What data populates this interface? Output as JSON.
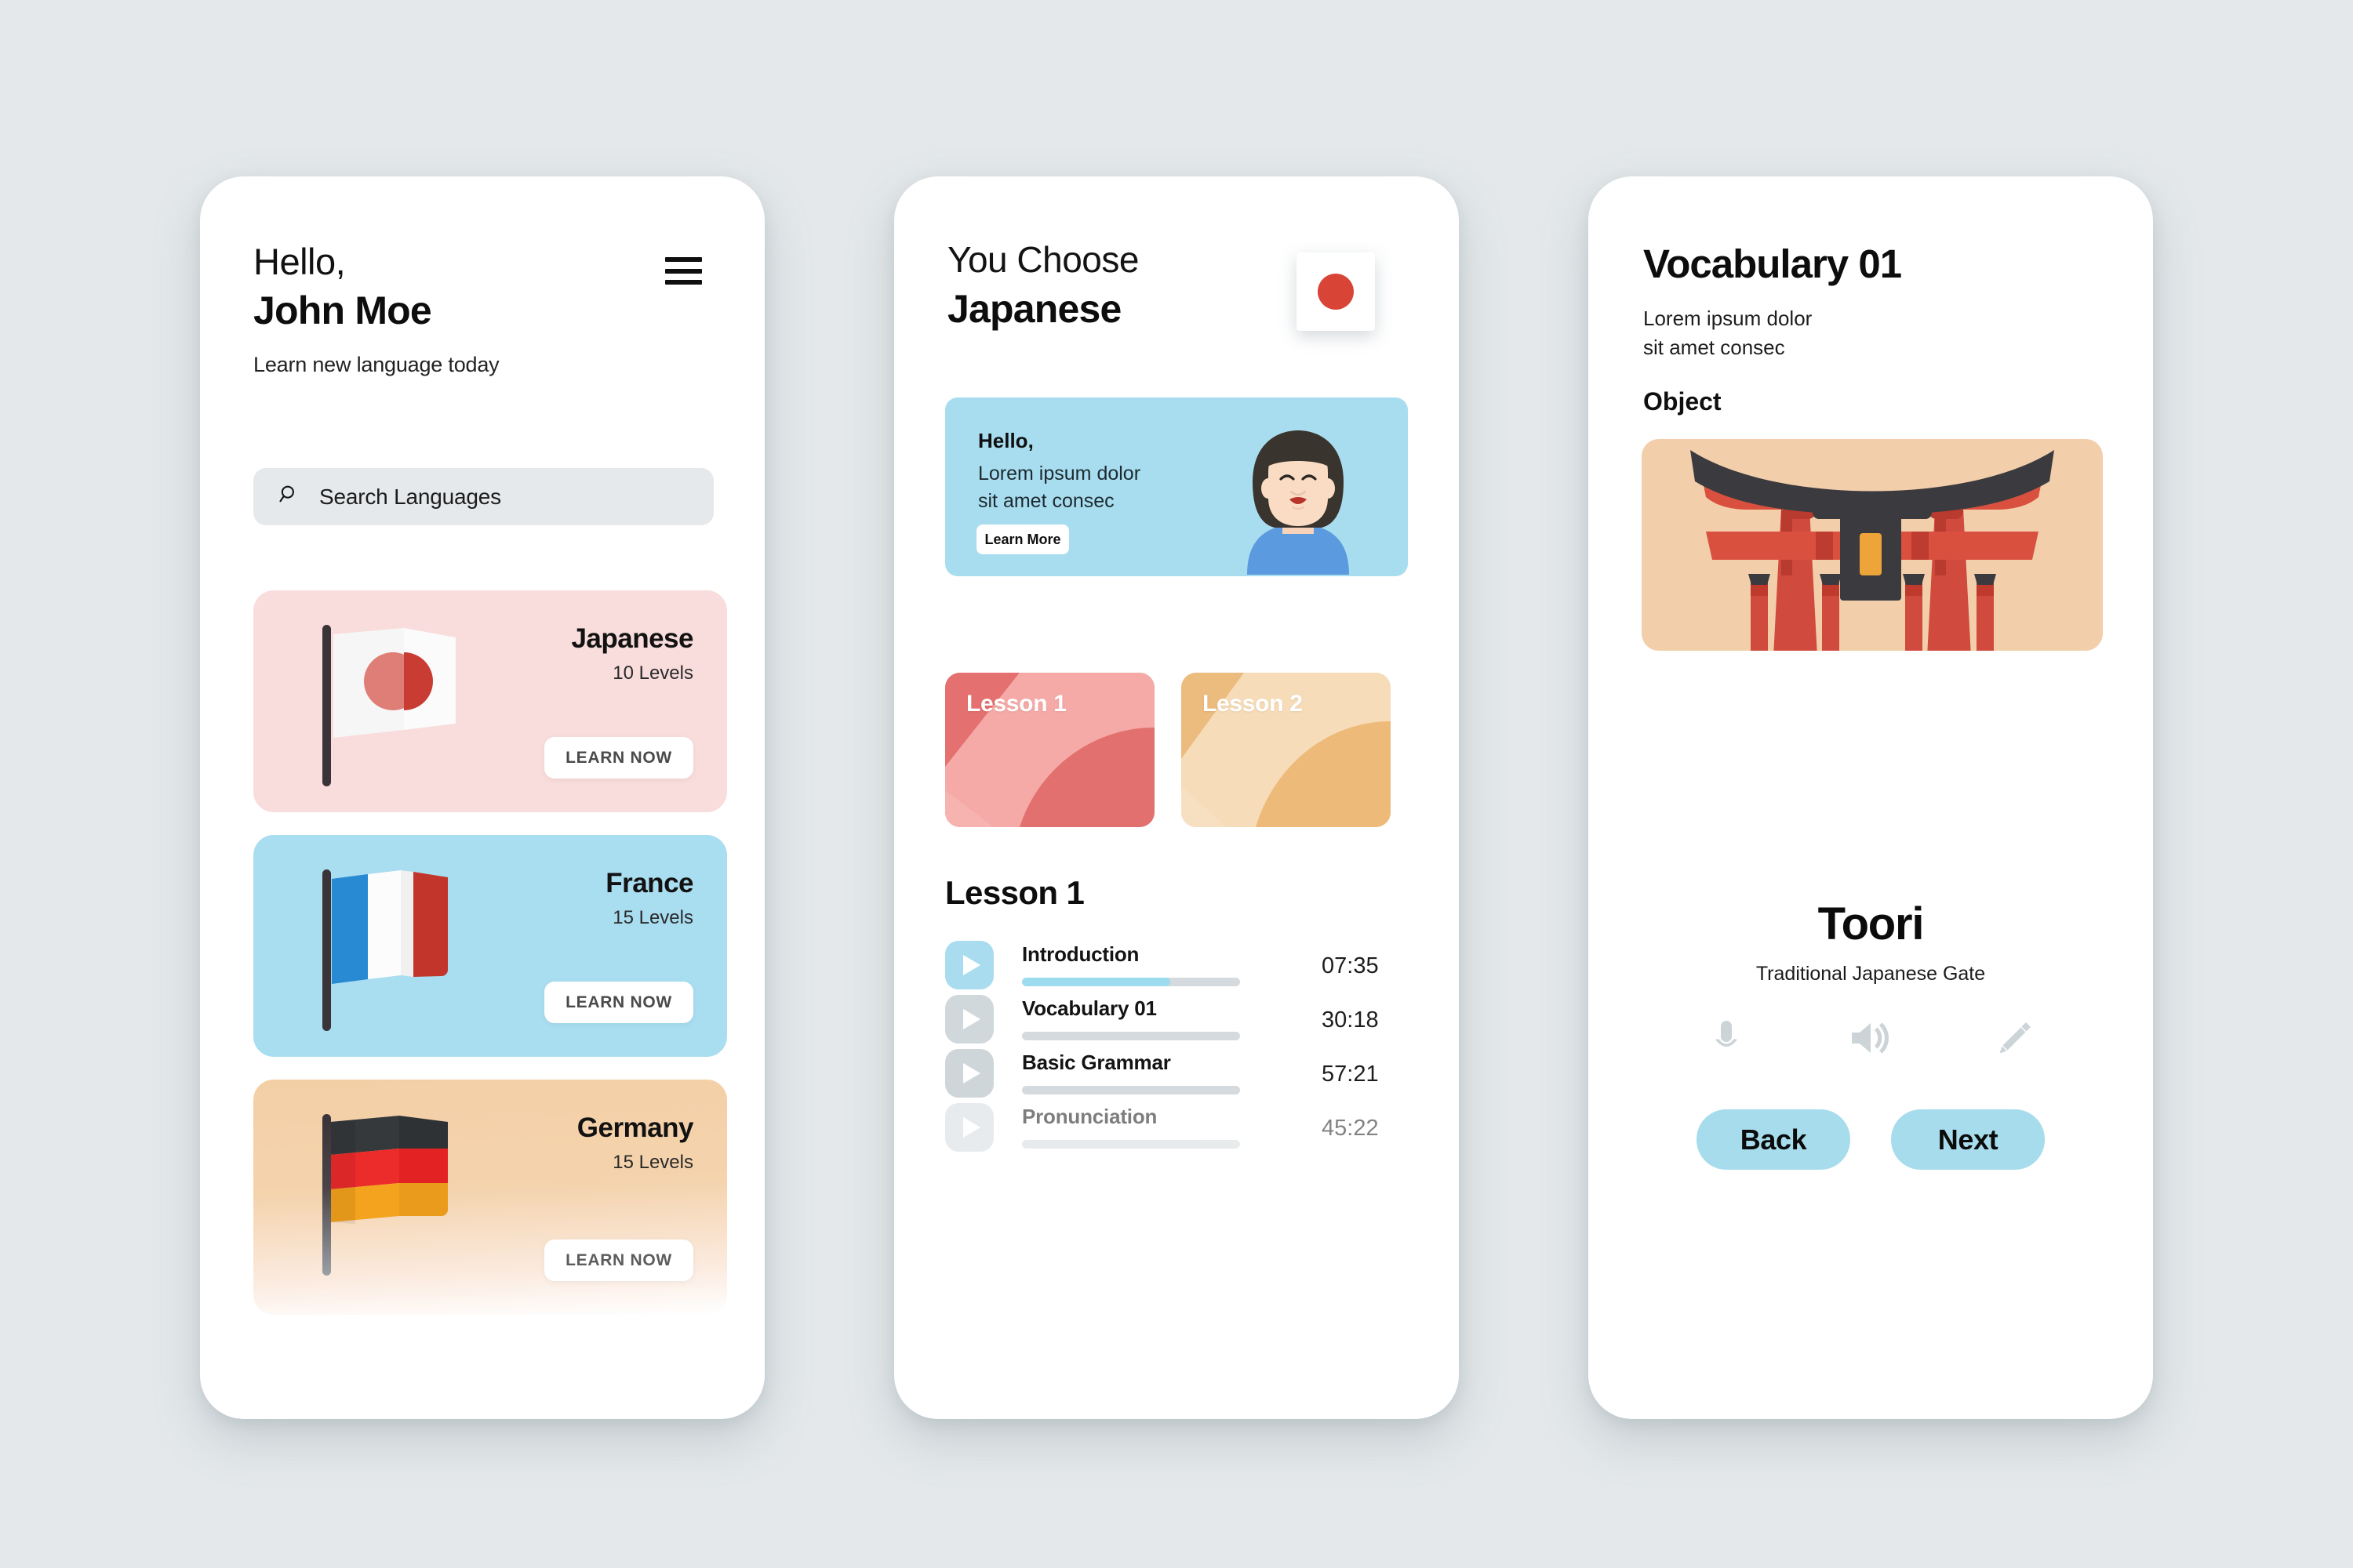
{
  "theme": {
    "background": "#e4e8ea",
    "phone_surface": "#ffffff",
    "accent_blue": "#a8ddef",
    "accent_pink": "#f9dcdc",
    "accent_peach": "#f2ceab",
    "accent_red": "#d84436",
    "muted_gray": "#d4dadd"
  },
  "screen1": {
    "greeting_line1": "Hello,",
    "greeting_name": "John Moe",
    "subtitle": "Learn new language today",
    "menu_icon": "hamburger-menu-icon",
    "search": {
      "icon": "search-icon",
      "placeholder": "Search Languages",
      "value": ""
    },
    "languages": [
      {
        "name": "Japanese",
        "levels": "10 Levels",
        "cta": "LEARN NOW",
        "flag": "japan-flag-icon",
        "bg": "#f9dcdc"
      },
      {
        "name": "France",
        "levels": "15 Levels",
        "cta": "LEARN NOW",
        "flag": "france-flag-icon",
        "bg": "#a9ddf0"
      },
      {
        "name": "Germany",
        "levels": "15 Levels",
        "cta": "LEARN NOW",
        "flag": "germany-flag-icon",
        "bg": "#f3cfa6"
      }
    ]
  },
  "screen2": {
    "header_line1": "You Choose",
    "header_line2": "Japanese",
    "flag_badge": "japan-flag-badge-icon",
    "banner": {
      "title": "Hello,",
      "body_line1": "Lorem ipsum dolor",
      "body_line2": "sit amet consec",
      "button": "Learn More",
      "illustration": "woman-avatar-illustration"
    },
    "lesson_tiles": [
      {
        "label": "Lesson 1",
        "color": "#ef8e8e"
      },
      {
        "label": "Lesson 2",
        "color": "#eec289"
      }
    ],
    "lesson_section_title": "Lesson 1",
    "lessons": [
      {
        "name": "Introduction",
        "time": "07:35",
        "progress": 68,
        "active": true
      },
      {
        "name": "Vocabulary 01",
        "time": "30:18",
        "progress": 0,
        "active": false
      },
      {
        "name": "Basic Grammar",
        "time": "57:21",
        "progress": 0,
        "active": false
      },
      {
        "name": "Pronunciation",
        "time": "45:22",
        "progress": 0,
        "active": false
      }
    ]
  },
  "screen3": {
    "title": "Vocabulary 01",
    "subtitle_line1": "Lorem ipsum dolor",
    "subtitle_line2": "sit amet consec",
    "section_label": "Object",
    "illustration": "torii-gate-illustration",
    "word": "Toori",
    "word_description": "Traditional Japanese Gate",
    "tools": [
      {
        "name": "microphone-icon"
      },
      {
        "name": "speaker-icon"
      },
      {
        "name": "pencil-icon"
      }
    ],
    "back_button": "Back",
    "next_button": "Next"
  }
}
